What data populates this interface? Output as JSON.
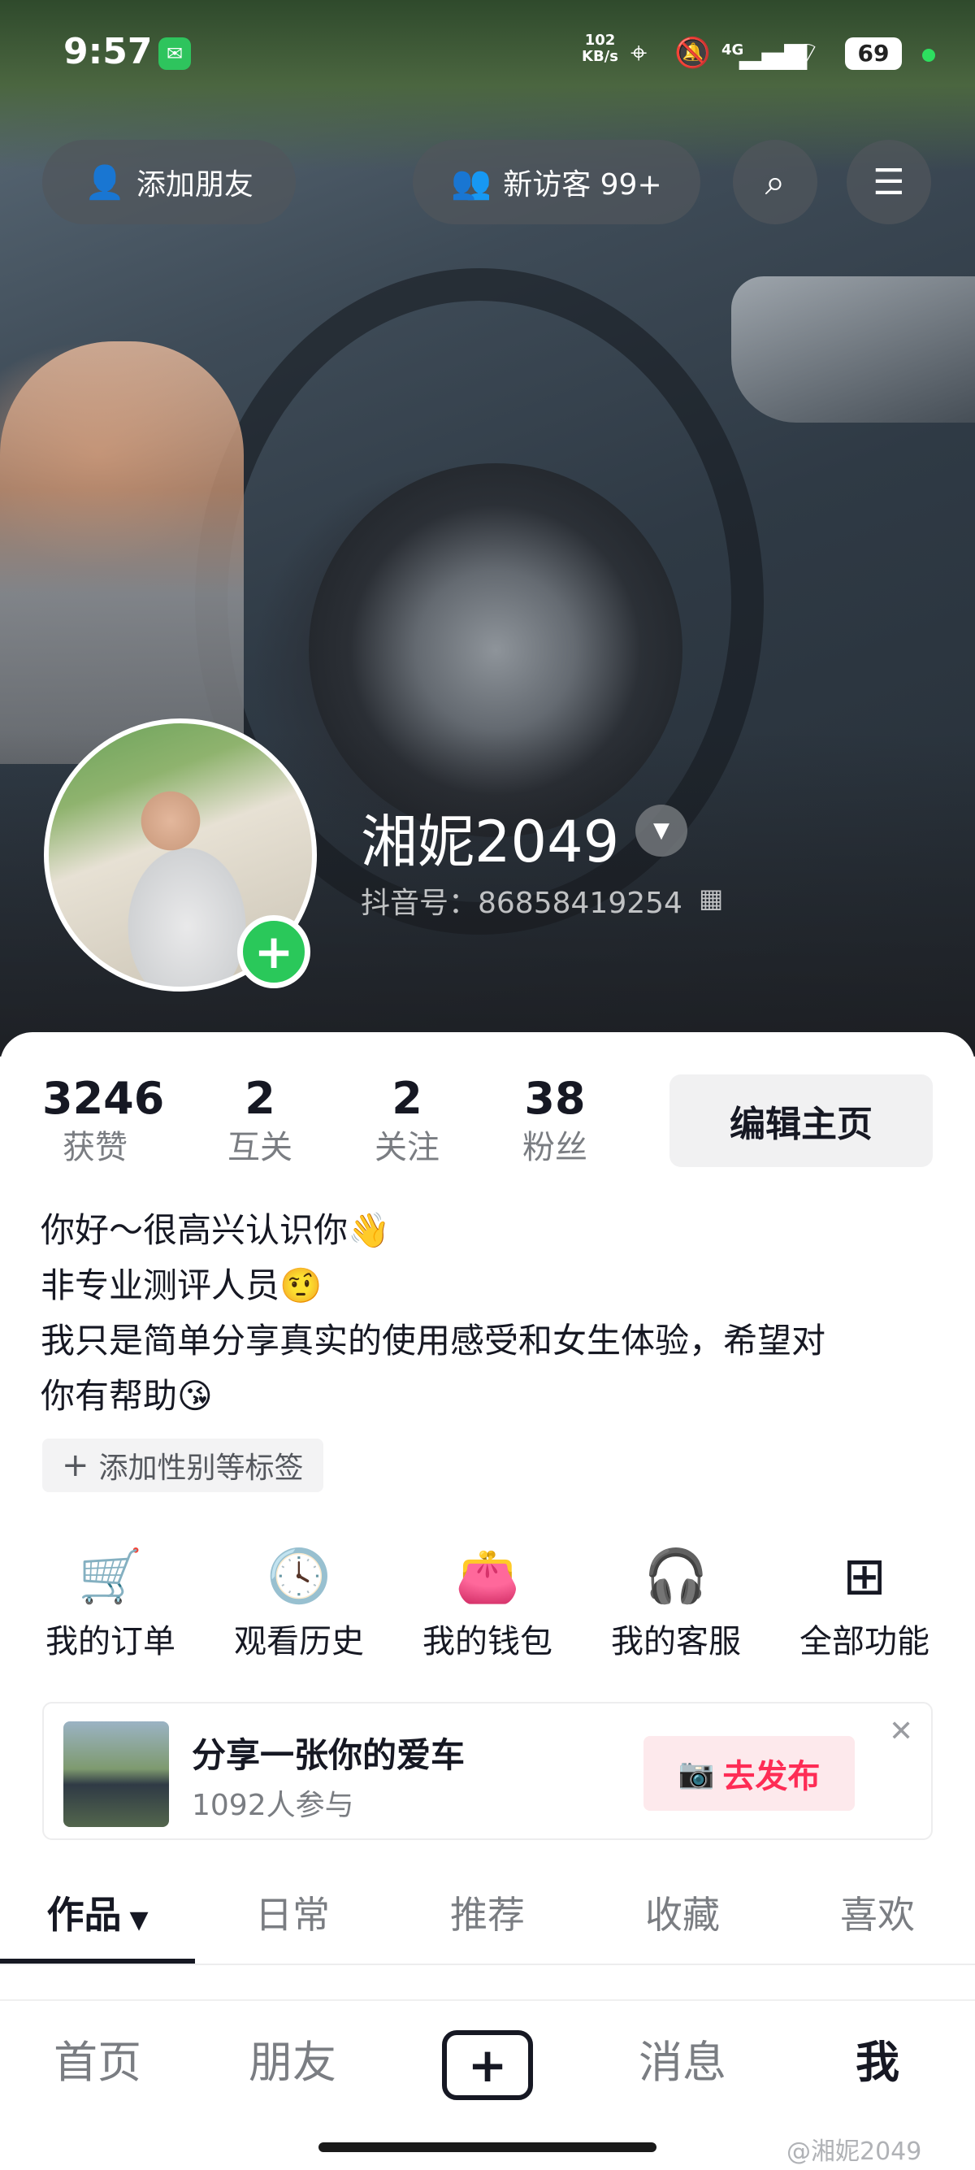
{
  "status_bar": {
    "time": "9:57",
    "net_speed_value": "102",
    "net_speed_unit": "KB/s",
    "cellular": "4G",
    "battery": "69"
  },
  "header": {
    "add_friend": "添加朋友",
    "visitors": "新访客 99+"
  },
  "profile": {
    "nickname": "湘妮2049",
    "douyin_id": "抖音号：86858419254"
  },
  "stats": [
    {
      "num": "3246",
      "label": "获赞"
    },
    {
      "num": "2",
      "label": "互关"
    },
    {
      "num": "2",
      "label": "关注"
    },
    {
      "num": "38",
      "label": "粉丝"
    }
  ],
  "edit_button": "编辑主页",
  "bio": [
    "你好～很高兴认识你👋",
    "非专业测评人员🤨",
    "我只是简单分享真实的使用感受和女生体验，希望对",
    "你有帮助😘"
  ],
  "tag_chip": "添加性别等标签",
  "shortcuts": [
    {
      "icon": "cart-icon",
      "label": "我的订单"
    },
    {
      "icon": "clock-icon",
      "label": "观看历史"
    },
    {
      "icon": "wallet-icon",
      "label": "我的钱包"
    },
    {
      "icon": "headset-icon",
      "label": "我的客服"
    },
    {
      "icon": "grid-icon",
      "label": "全部功能"
    }
  ],
  "promo": {
    "title": "分享一张你的爱车",
    "participants": "1092人参与",
    "publish": "去发布"
  },
  "tabs": [
    "作品",
    "日常",
    "推荐",
    "收藏",
    "喜欢"
  ],
  "bottom_nav": {
    "home": "首页",
    "friends": "朋友",
    "messages": "消息",
    "me": "我"
  },
  "watermark": "@湘妮2049",
  "colors": {
    "accent_red": "#fe2c55",
    "green_add": "#2ac85a",
    "text_primary": "#161823",
    "text_secondary": "#7a7d82"
  }
}
